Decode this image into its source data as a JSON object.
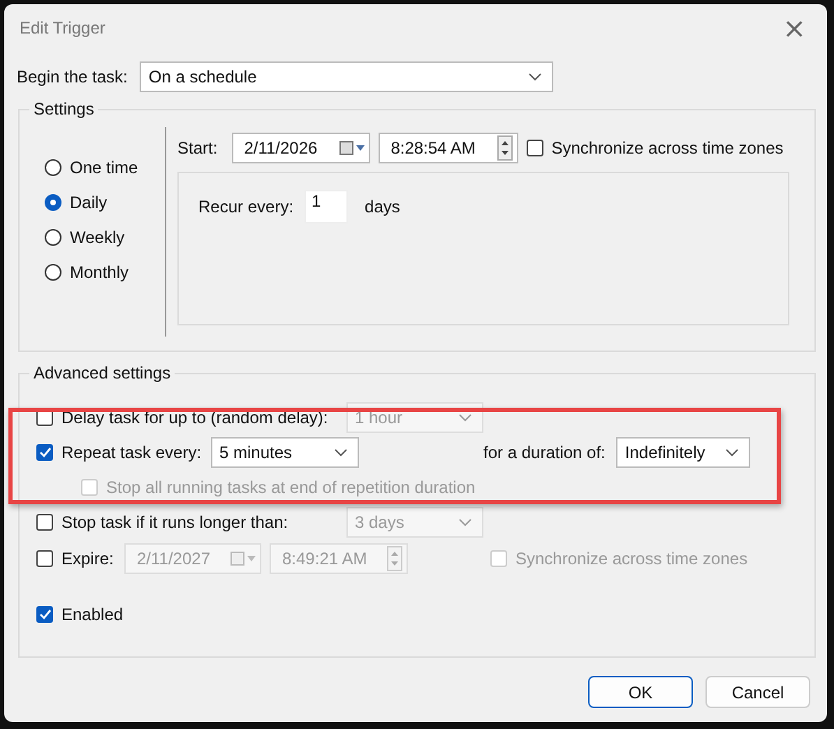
{
  "window": {
    "title": "Edit Trigger",
    "close": "×"
  },
  "begin_task": {
    "label": "Begin the task:",
    "value": "On a schedule"
  },
  "settings": {
    "title": "Settings",
    "schedule_options": [
      {
        "label": "One time",
        "selected": false
      },
      {
        "label": "Daily",
        "selected": true
      },
      {
        "label": "Weekly",
        "selected": false
      },
      {
        "label": "Monthly",
        "selected": false
      }
    ],
    "start": {
      "label": "Start:",
      "date": "2/11/2026",
      "time": "8:28:54 AM"
    },
    "sync": {
      "label": "Synchronize across time zones",
      "checked": false
    },
    "recur": {
      "label": "Recur every:",
      "value": "1",
      "unit": "days"
    }
  },
  "advanced": {
    "title": "Advanced settings",
    "delay": {
      "label": "Delay task for up to (random delay):",
      "checked": false,
      "value": "1 hour",
      "disabled": true
    },
    "repeat": {
      "label": "Repeat task every:",
      "checked": true,
      "value": "5 minutes",
      "duration_label": "for a duration of:",
      "duration": "Indefinitely"
    },
    "stop_all": {
      "label": "Stop all running tasks at end of repetition duration",
      "checked": false,
      "disabled": true
    },
    "stop_task": {
      "label": "Stop task if it runs longer than:",
      "checked": false,
      "value": "3 days",
      "disabled": true
    },
    "expire": {
      "label": "Expire:",
      "checked": false,
      "date": "2/11/2027",
      "time": "8:49:21 AM",
      "disabled": true,
      "sync_label": "Synchronize across time zones",
      "sync_checked": false
    },
    "enabled": {
      "label": "Enabled",
      "checked": true
    }
  },
  "buttons": [
    {
      "label": "OK",
      "default": true
    },
    {
      "label": "Cancel",
      "default": false
    }
  ]
}
